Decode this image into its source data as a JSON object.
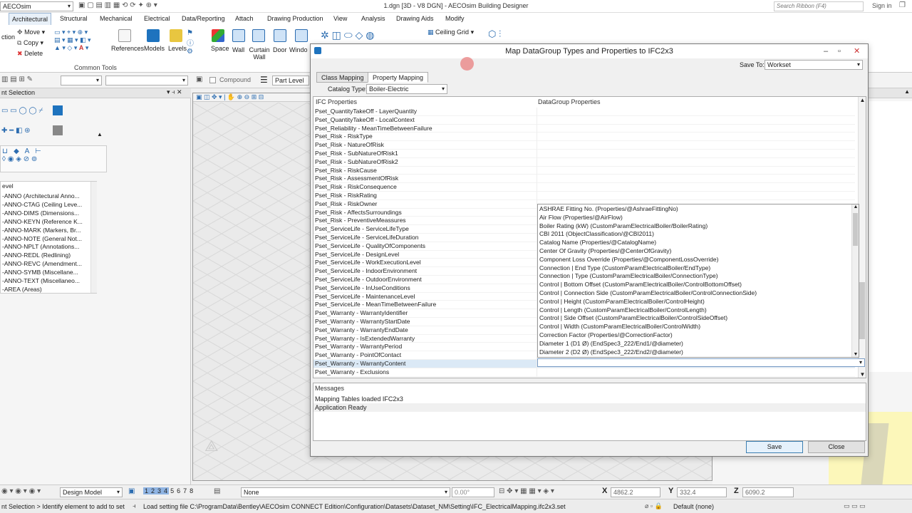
{
  "app": {
    "workspace": "AECOsim",
    "window_title": "1.dgn [3D - V8 DGN] - AECOsim Building Designer",
    "search_placeholder": "Search Ribbon (F4)",
    "sign_in": "Sign in"
  },
  "ribbon_tabs": [
    "Architectural",
    "Structural",
    "Mechanical",
    "Electrical",
    "Data/Reporting",
    "Attach",
    "Drawing Production",
    "View",
    "Analysis",
    "Drawing Aids",
    "Modify"
  ],
  "ribbon": {
    "move": "Move",
    "copy": "Copy",
    "delete": "Delete",
    "group_common": "Common Tools",
    "references": "References",
    "models": "Models",
    "levels": "Levels",
    "space": "Space",
    "wall": "Wall",
    "curtain_wall": "Curtain Wall",
    "door": "Door",
    "window": "Windo",
    "ceiling_grid": "Ceiling Grid"
  },
  "toolbar2": {
    "compound": "Compound",
    "part_level": "Part Level"
  },
  "left_panel": {
    "title": "nt Selection",
    "level_header": "evel",
    "levels": [
      "-ANNO (Architectural Anno...",
      "-ANNO-CTAG (Ceiling Leve...",
      "-ANNO-DIMS (Dimensions...",
      "-ANNO-KEYN (Reference K...",
      "-ANNO-MARK (Markers, Br...",
      "-ANNO-NOTE (General Not...",
      "-ANNO-NPLT (Annotations...",
      "-ANNO-REDL (Redlining)",
      "-ANNO-REVC (Amendment...",
      "-ANNO-SYMB (Miscellane...",
      "-ANNO-TEXT (Miscellaneo...",
      "-AREA (Areas)"
    ]
  },
  "dialog": {
    "title": "Map DataGroup Types and Properties to IFC2x3",
    "save_to_label": "Save To:",
    "save_to_value": "Workset",
    "tabs": [
      "Class Mapping",
      "Property Mapping"
    ],
    "catalog_type_label": "Catalog Type:",
    "catalog_type_value": "Boiler-Electric",
    "col_ifc": "IFC Properties",
    "col_datagroup": "DataGroup Properties",
    "ifc_rows": [
      "Pset_QuantityTakeOff - LayerQuantity",
      "Pset_QuantityTakeOff - LocalContext",
      "Pset_Reliability - MeanTimeBetweenFailure",
      "Pset_Risk - RiskType",
      "Pset_Risk - NatureOfRisk",
      "Pset_Risk - SubNatureOfRisk1",
      "Pset_Risk - SubNatureOfRisk2",
      "Pset_Risk - RiskCause",
      "Pset_Risk - AssessmentOfRisk",
      "Pset_Risk - RiskConsequence",
      "Pset_Risk - RiskRating",
      "Pset_Risk - RiskOwner",
      "Pset_Risk - AffectsSurroundings",
      "Pset_Risk - PreventiveMeassures",
      "Pset_ServiceLife - ServiceLifeType",
      "Pset_ServiceLife - ServiceLifeDuration",
      "Pset_ServiceLife - QualityOfComponents",
      "Pset_ServiceLife - DesignLevel",
      "Pset_ServiceLife - WorkExecutionLevel",
      "Pset_ServiceLife - IndoorEnvironment",
      "Pset_ServiceLife - OutdoorEnvironment",
      "Pset_ServiceLife - InUseConditions",
      "Pset_ServiceLife - MaintenanceLevel",
      "Pset_ServiceLife - MeanTimeBetweenFailure",
      "Pset_Warranty - WarrantyIdentifier",
      "Pset_Warranty - WarrantyStartDate",
      "Pset_Warranty - WarrantyEndDate",
      "Pset_Warranty - IsExtendedWarranty",
      "Pset_Warranty - WarrantyPeriod",
      "Pset_Warranty - PointOfContact",
      "Pset_Warranty - WarrantyContent",
      "Pset_Warranty - Exclusions"
    ],
    "selected_row": "Pset_Warranty - WarrantyContent",
    "dropdown_items": [
      "ASHRAE Fitting No. (Properties/@AshraeFittingNo)",
      "Air Flow (Properties/@AirFlow)",
      "Boiler Rating (kW) (CustomParamElectricalBoiler/BoilerRating)",
      "CBI 2011 (ObjectClassification/@CBI2011)",
      "Catalog Name (Properties/@CatalogName)",
      "Center Of Gravity (Properties/@CenterOfGravity)",
      "Component Loss Override (Properties/@ComponentLossOverride)",
      "Connection | End Type (CustomParamElectricalBoiler/EndType)",
      "Connection | Type (CustomParamElectricalBoiler/ConnectionType)",
      "Control | Bottom Offset (CustomParamElectricalBoiler/ControlBottomOffset)",
      "Control | Connection Side (CustomParamElectricalBoiler/ControlConnectionSide)",
      "Control | Height (CustomParamElectricalBoiler/ControlHeight)",
      "Control | Length (CustomParamElectricalBoiler/ControlLength)",
      "Control | Side Offset (CustomParamElectricalBoiler/ControlSideOffset)",
      "Control | Width (CustomParamElectricalBoiler/ControlWidth)",
      "Correction Factor (Properties/@CorrectionFactor)",
      "Diameter 1 (D1 Ø) (EndSpec3_222/End1/@diameter)",
      "Diameter 2 (D2 Ø) (EndSpec3_222/End2/@diameter)"
    ],
    "messages_label": "Messages",
    "messages": [
      "Mapping Tables loaded IFC2x3",
      "Application Ready"
    ],
    "save_button": "Save",
    "close_button": "Close"
  },
  "bottom_bar": {
    "model": "Design Model",
    "views": [
      "1",
      "2",
      "3",
      "4",
      "5",
      "6",
      "7",
      "8"
    ],
    "none": "None",
    "angle": "0.00°",
    "x_label": "X",
    "x_value": "4862.2",
    "y_label": "Y",
    "y_value": "332.4",
    "z_label": "Z",
    "z_value": "6090.2"
  },
  "status": {
    "left": "nt Selection > Identify element to add to set",
    "message": "Load setting file C:\\ProgramData\\Bentley\\AECOsim CONNECT Edition\\Configuration\\Datasets\\Dataset_NM\\Setting\\IFC_ElectricalMapping.ifc2x3.set",
    "level": "Default (none)"
  },
  "colors": {
    "accent": "#1e73be",
    "selection": "#dbe9f6",
    "highlight_yellow": "#fff79a",
    "cursor_red": "#e87878"
  }
}
